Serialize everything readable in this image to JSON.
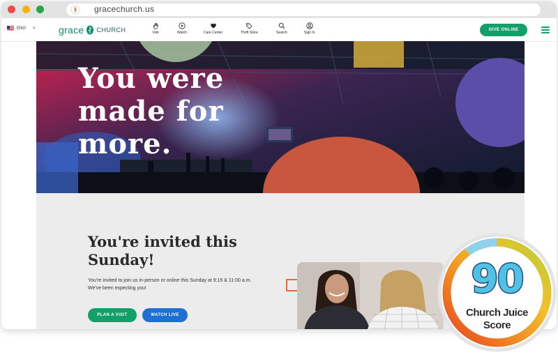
{
  "browser": {
    "url": "gracechurch.us"
  },
  "nav": {
    "language": "ENG",
    "language_arrow": ">",
    "logo_grace": "grace",
    "logo_church": "CHURCH",
    "items": [
      {
        "label": "Visit",
        "icon": "hand-wave-icon"
      },
      {
        "label": "Watch",
        "icon": "play-icon"
      },
      {
        "label": "Care Center",
        "icon": "heart-hands-icon"
      },
      {
        "label": "Thrift Store",
        "icon": "tag-icon"
      },
      {
        "label": "Search",
        "icon": "search-icon"
      },
      {
        "label": "Sign In",
        "icon": "user-icon"
      }
    ],
    "give_label": "GIVE ONLINE"
  },
  "hero": {
    "title_line1": "You were",
    "title_line2": "made for",
    "title_line3": "more."
  },
  "invite": {
    "title": "You're invited this Sunday!",
    "text": "You're invited to join us in-person or online this Sunday at 9:15 & 11:00 a.m. We've been expecting you!",
    "plan_visit_label": "PLAN A VISIT",
    "watch_live_label": "WATCH LIVE"
  },
  "score_badge": {
    "score": "90",
    "label_line1": "Church Juice",
    "label_line2": "Score"
  },
  "colors": {
    "brand_green": "#13a068",
    "watch_blue": "#1d6fd3",
    "hero_purple": "#5b4ea8",
    "hero_coral": "#c8573f",
    "hero_mustard": "#c9a43c"
  }
}
